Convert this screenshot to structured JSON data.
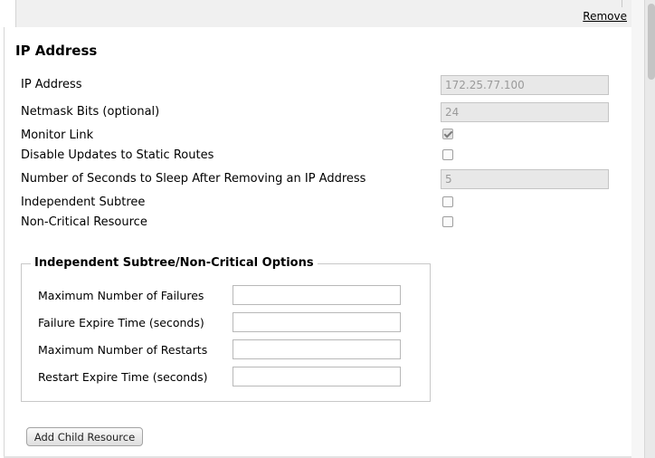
{
  "header": {
    "remove_label": "Remove"
  },
  "section": {
    "title": "IP Address"
  },
  "fields": {
    "ip_address": {
      "label": "IP Address",
      "value": "172.25.77.100"
    },
    "netmask": {
      "label": "Netmask Bits (optional)",
      "value": "24"
    },
    "monitor_link": {
      "label": "Monitor Link",
      "checked": true
    },
    "disable_updates": {
      "label": "Disable Updates to Static Routes",
      "checked": false
    },
    "sleep_seconds": {
      "label": "Number of Seconds to Sleep After Removing an IP Address",
      "value": "5"
    },
    "independent_subtree": {
      "label": "Independent Subtree",
      "checked": false
    },
    "non_critical": {
      "label": "Non-Critical Resource",
      "checked": false
    }
  },
  "options": {
    "legend": "Independent Subtree/Non-Critical Options",
    "max_failures": {
      "label": "Maximum Number of Failures",
      "value": ""
    },
    "failure_expire": {
      "label": "Failure Expire Time (seconds)",
      "value": ""
    },
    "max_restarts": {
      "label": "Maximum Number of Restarts",
      "value": ""
    },
    "restart_expire": {
      "label": "Restart Expire Time (seconds)",
      "value": ""
    }
  },
  "actions": {
    "add_child_label": "Add Child Resource"
  }
}
